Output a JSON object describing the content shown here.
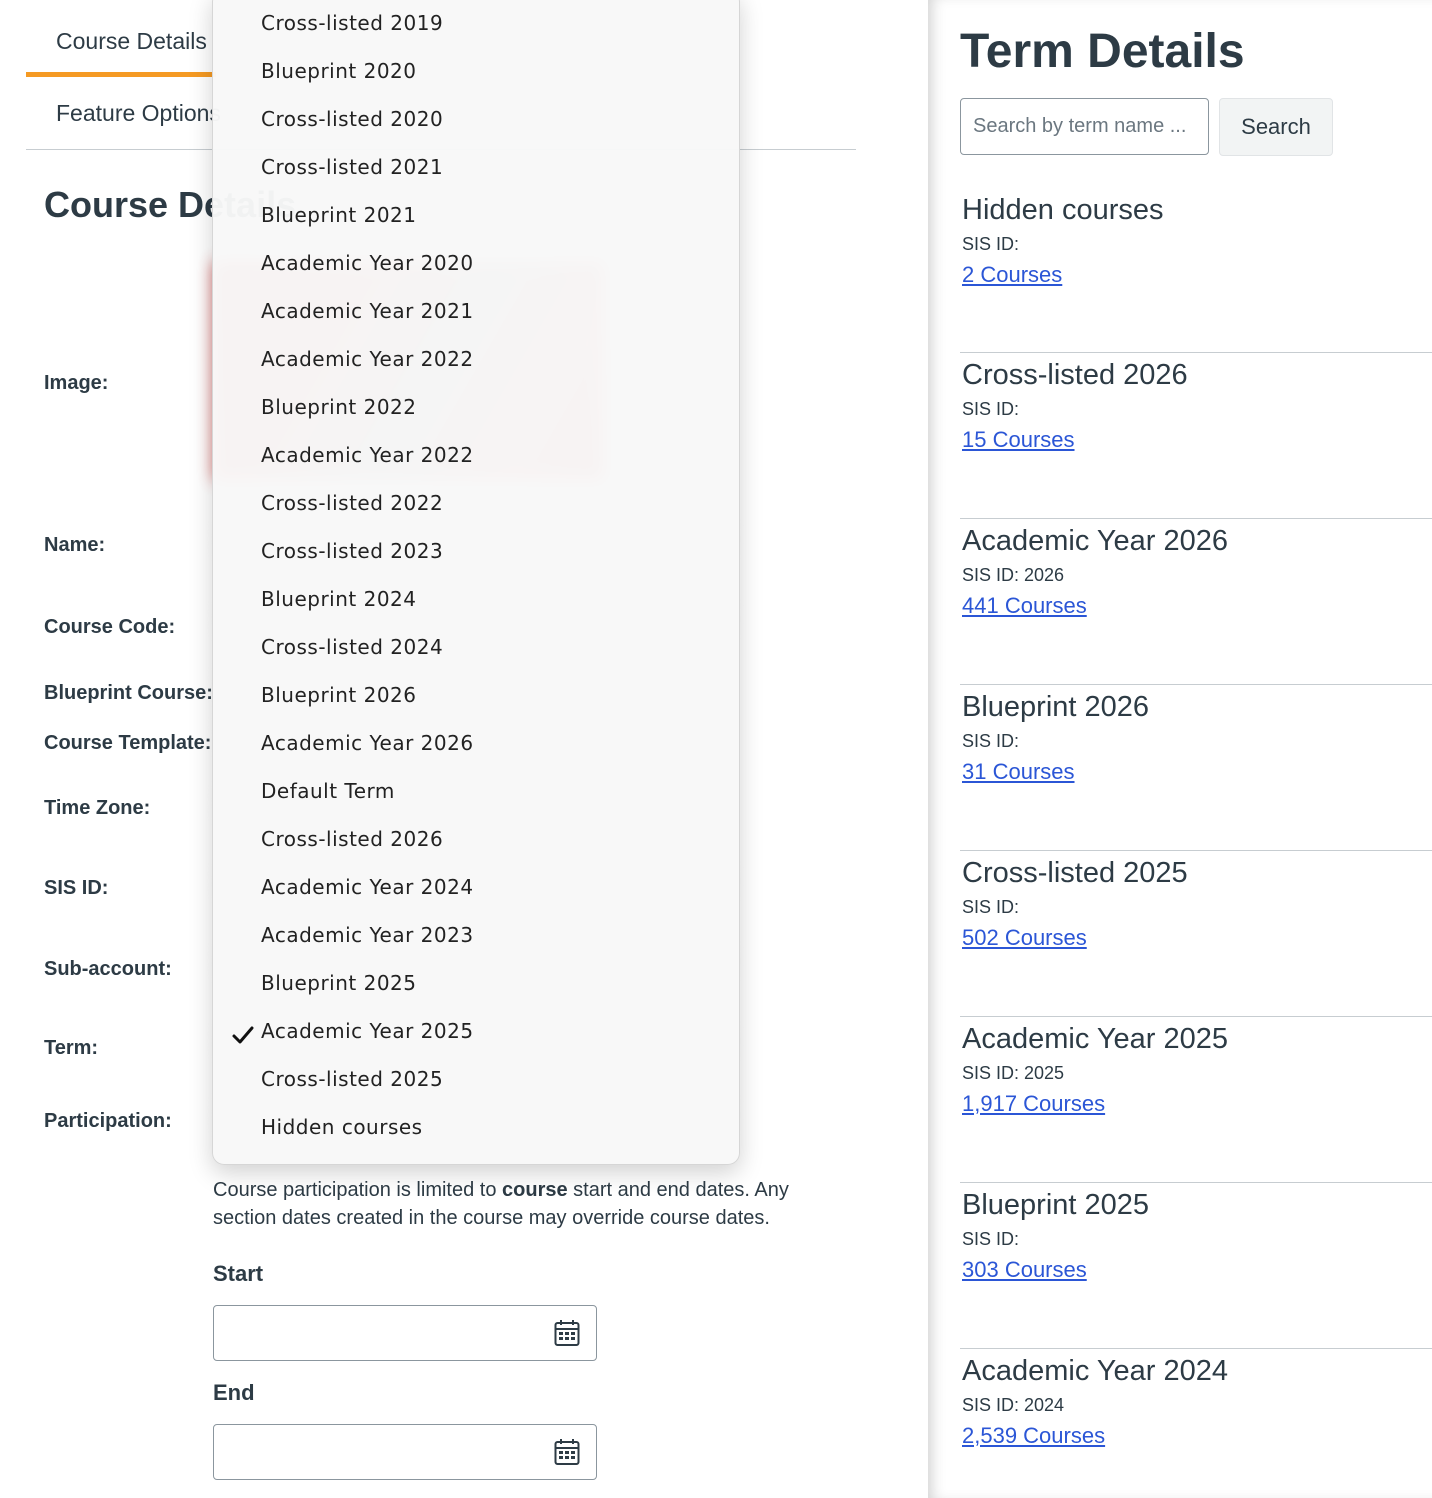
{
  "tabs": [
    {
      "label": "Course Details",
      "active": true
    },
    {
      "label": "Feature Options",
      "active": false
    }
  ],
  "page_title": "Course Details",
  "form_labels": {
    "image": "Image:",
    "name": "Name:",
    "course_code": "Course Code:",
    "blueprint_course": "Blueprint Course:",
    "course_template": "Course Template:",
    "time_zone": "Time Zone:",
    "sis_id": "SIS ID:",
    "sub_account": "Sub-account:",
    "term": "Term:",
    "participation": "Participation:"
  },
  "participation": {
    "text_before": "Course participation is limited to ",
    "text_bold": "course",
    "text_after": " start and end dates. Any section dates created in the course may override course dates.",
    "start_label": "Start",
    "end_label": "End"
  },
  "term_dropdown": {
    "selected": "Academic Year 2025",
    "options": [
      "Cross-listed 2019",
      "Blueprint 2020",
      "Cross-listed 2020",
      "Cross-listed 2021",
      "Blueprint 2021",
      "Academic Year 2020",
      "Academic Year 2021",
      "Academic Year 2022",
      "Blueprint 2022",
      "Academic Year 2022",
      "Cross-listed 2022",
      "Cross-listed 2023",
      "Blueprint 2024",
      "Cross-listed 2024",
      "Blueprint 2026",
      "Academic Year 2026",
      "Default Term",
      "Cross-listed 2026",
      "Academic Year 2024",
      "Academic Year 2023",
      "Blueprint 2025",
      "Academic Year 2025",
      "Cross-listed 2025",
      "Hidden courses"
    ]
  },
  "term_details": {
    "title": "Term Details",
    "search_placeholder": "Search by term name ...",
    "search_button": "Search",
    "terms": [
      {
        "name": "Hidden courses",
        "sis": "SIS ID:",
        "courses": "2 Courses"
      },
      {
        "name": "Cross-listed 2026",
        "sis": "SIS ID:",
        "courses": "15 Courses"
      },
      {
        "name": "Academic Year 2026",
        "sis": "SIS ID: 2026",
        "courses": "441 Courses"
      },
      {
        "name": "Blueprint 2026",
        "sis": "SIS ID:",
        "courses": "31 Courses"
      },
      {
        "name": "Cross-listed 2025",
        "sis": "SIS ID:",
        "courses": "502 Courses"
      },
      {
        "name": "Academic Year 2025",
        "sis": "SIS ID: 2025",
        "courses": "1,917 Courses"
      },
      {
        "name": "Blueprint 2025",
        "sis": "SIS ID:",
        "courses": "303 Courses"
      },
      {
        "name": "Academic Year 2024",
        "sis": "SIS ID: 2024",
        "courses": "2,539 Courses"
      }
    ]
  },
  "colors": {
    "tab_active": "#f59a23",
    "link": "#2b56d6",
    "text": "#2d3b45"
  },
  "icons": {
    "calendar": "calendar-icon",
    "check": "checkmark-icon"
  }
}
